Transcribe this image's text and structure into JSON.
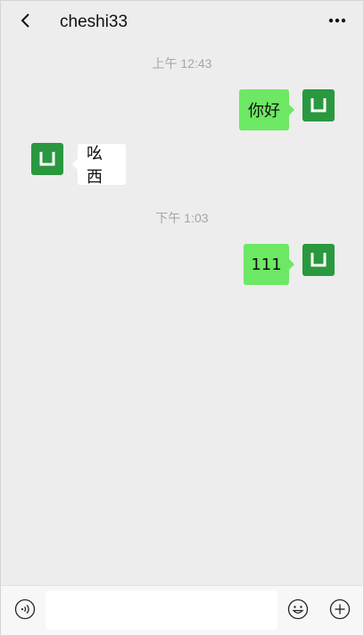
{
  "header": {
    "back_icon": "chevron-left-icon",
    "title": "cheshi33",
    "more_icon": "ellipsis-icon"
  },
  "messages": [
    {
      "type": "timestamp",
      "text": "上午 12:43"
    },
    {
      "type": "sent",
      "text": "你好"
    },
    {
      "type": "received",
      "text": "吆西"
    },
    {
      "type": "timestamp",
      "text": "下午 1:03"
    },
    {
      "type": "sent",
      "text": "111"
    }
  ],
  "input_bar": {
    "voice_icon": "voice-icon",
    "input_value": "",
    "emoji_icon": "emoji-icon",
    "plus_icon": "plus-icon"
  },
  "colors": {
    "background": "#ededed",
    "sent_bubble": "#6de864",
    "received_bubble": "#ffffff",
    "avatar": "#2a983f",
    "timestamp_text": "#a6a6a6"
  }
}
